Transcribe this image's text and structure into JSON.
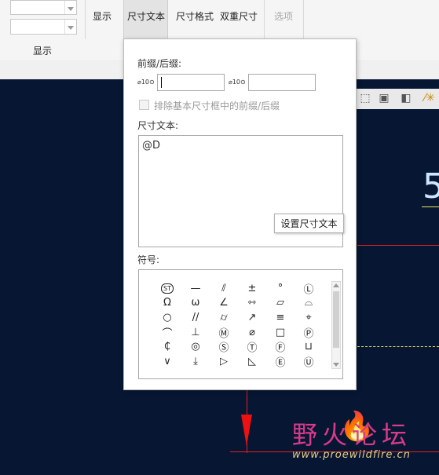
{
  "ribbon": {
    "display_button": "显示",
    "group_label": "显示",
    "dim_text_tab": "尺寸文本",
    "dim_format": "尺寸格式",
    "dual_dim": "双重尺寸",
    "options": "选项"
  },
  "panel": {
    "prefix_suffix_label": "前缀/后缀:",
    "prefix_icon": "⌀10⊙",
    "suffix_icon": "⌀10⊙",
    "prefix_value": "",
    "suffix_value": "",
    "exclude_checkbox_label": "排除基本尺寸框中的前缀/后缀",
    "dim_text_label": "尺寸文本:",
    "dim_text_value": "@D",
    "tooltip": "设置尺寸文本",
    "symbols_label": "符号:",
    "symbols": [
      {
        "glyph": "ST",
        "name": "statistical-tolerance"
      },
      {
        "glyph": "—",
        "name": "flatness"
      },
      {
        "glyph": "⫽",
        "name": "total-runout"
      },
      {
        "glyph": "±",
        "name": "plus-minus"
      },
      {
        "glyph": "°",
        "name": "degree"
      },
      {
        "glyph": "Ⓛ",
        "name": "least-material"
      },
      {
        "glyph": "Ω",
        "name": "omega"
      },
      {
        "glyph": "ω",
        "name": "small-omega"
      },
      {
        "glyph": "∠",
        "name": "angularity"
      },
      {
        "glyph": "⇿",
        "name": "symmetric-arrows"
      },
      {
        "glyph": "▱",
        "name": "parallelogram"
      },
      {
        "glyph": "⌓",
        "name": "profile-surface"
      },
      {
        "glyph": "○",
        "name": "circularity"
      },
      {
        "glyph": "//",
        "name": "parallelism"
      },
      {
        "glyph": "⌭",
        "name": "cylindricity"
      },
      {
        "glyph": "↗",
        "name": "circular-runout"
      },
      {
        "glyph": "≡",
        "name": "symmetry"
      },
      {
        "glyph": "⌖",
        "name": "position"
      },
      {
        "glyph": "⌒",
        "name": "profile-line"
      },
      {
        "glyph": "⊥",
        "name": "perpendicularity"
      },
      {
        "glyph": "Ⓜ",
        "name": "max-material"
      },
      {
        "glyph": "⌀",
        "name": "diameter"
      },
      {
        "glyph": "□",
        "name": "square"
      },
      {
        "glyph": "Ⓟ",
        "name": "projected-zone"
      },
      {
        "glyph": "₵",
        "name": "centerline"
      },
      {
        "glyph": "◎",
        "name": "concentricity"
      },
      {
        "glyph": "Ⓢ",
        "name": "regardless-feature-size"
      },
      {
        "glyph": "Ⓣ",
        "name": "tangent-plane"
      },
      {
        "glyph": "Ⓕ",
        "name": "free-state"
      },
      {
        "glyph": "⊔",
        "name": "counterbore"
      },
      {
        "glyph": "∨",
        "name": "countersink"
      },
      {
        "glyph": "⤓",
        "name": "depth"
      },
      {
        "glyph": "▷",
        "name": "conical-taper"
      },
      {
        "glyph": "◺",
        "name": "slope"
      },
      {
        "glyph": "Ⓔ",
        "name": "envelope"
      },
      {
        "glyph": "Ⓤ",
        "name": "unequal-profile"
      }
    ]
  },
  "canvas": {
    "digit": "5"
  },
  "watermark": {
    "cn": "野火论坛",
    "url": "www.proewildfire.cn"
  },
  "colors": {
    "canvas_bg": "#071733",
    "red": "#e02020",
    "dash_yellow": "#e8e25a"
  }
}
